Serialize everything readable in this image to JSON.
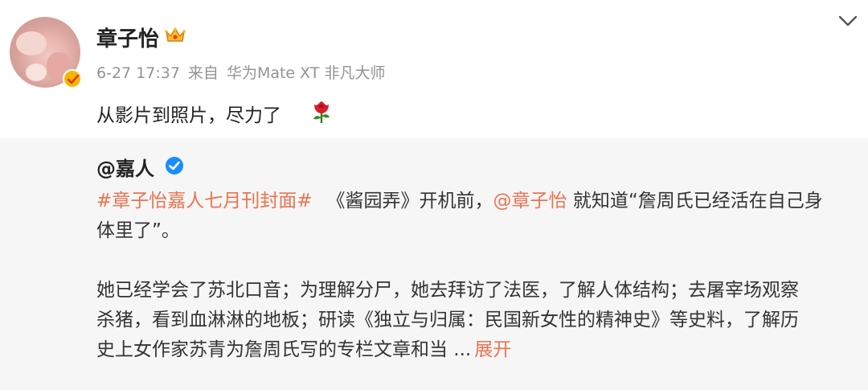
{
  "author": {
    "name": "章子怡",
    "timestamp": "6-27 17:37",
    "source_prefix": "来自",
    "source_device": "华为Mate XT 非凡大师"
  },
  "post": {
    "text": "从影片到照片，尽力了"
  },
  "repost": {
    "author": "@嘉人",
    "hashtag": "#章子怡嘉人七月刊封面#",
    "line1_mid": "《酱园弄》开机前，",
    "mention": "@章子怡",
    "line1_end": "就知道“詹周氏已经活在自己身",
    "line2": "体里了”。",
    "para2_line1": "她已经学会了苏北口音；为理解分尸，她去拜访了法医，了解人体结构；去屠宰场观察",
    "para2_line2": "杀猪，看到血淋淋的地板；研读《独立与归属：民国新女性的精神史》等史料，了解历",
    "para2_line3": "史上女作家苏青为詹周氏写的专栏文章和当 ...",
    "expand_label": "展开"
  },
  "icons": {
    "header_menu": "chevron-down-icon",
    "vip": "crown-icon",
    "avatar_badge": "verified-icon",
    "emoji": "rose-icon",
    "repost_badge": "verified-blue-icon"
  },
  "colors": {
    "link": "#eb7350",
    "badge_gold": "#f9b500",
    "badge_blue": "#1a8cff",
    "repost_bg": "#f6f6f6",
    "meta_text": "#939393"
  }
}
